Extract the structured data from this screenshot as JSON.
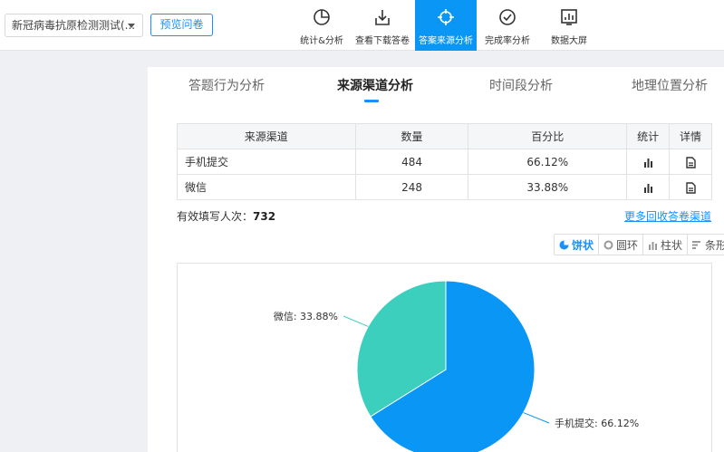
{
  "header": {
    "survey_title": "新冠病毒抗原检测测试(...",
    "preview_label": "预览问卷",
    "nav": [
      {
        "label": "统计&分析",
        "icon": "pie-chart-icon"
      },
      {
        "label": "查看下载答卷",
        "icon": "download-icon"
      },
      {
        "label": "答案来源分析",
        "icon": "crosshair-icon",
        "active": true
      },
      {
        "label": "完成率分析",
        "icon": "check-circle-icon"
      },
      {
        "label": "数据大屏",
        "icon": "dashboard-icon"
      }
    ]
  },
  "tabs": [
    {
      "label": "答题行为分析"
    },
    {
      "label": "来源渠道分析",
      "active": true
    },
    {
      "label": "时间段分析"
    },
    {
      "label": "地理位置分析"
    }
  ],
  "table": {
    "headers": [
      "来源渠道",
      "数量",
      "百分比",
      "统计",
      "详情"
    ],
    "rows": [
      {
        "channel": "手机提交",
        "count": "484",
        "percent": "66.12%"
      },
      {
        "channel": "微信",
        "count": "248",
        "percent": "33.88%"
      }
    ]
  },
  "summary": {
    "label": "有效填写人次：",
    "value": "732",
    "more_link": "更多回收答卷渠道"
  },
  "chart_switch": [
    {
      "label": "饼状",
      "active": true
    },
    {
      "label": "圆环"
    },
    {
      "label": "柱状"
    },
    {
      "label": "条形"
    }
  ],
  "colors": {
    "accent": "#1890ff",
    "slice_1": "#0a96f4",
    "slice_2": "#3ccfbe"
  },
  "chart_data": {
    "type": "pie",
    "categories": [
      "手机提交",
      "微信"
    ],
    "values": [
      66.12,
      33.88
    ],
    "labels": [
      "手机提交: 66.12%",
      "微信: 33.88%"
    ]
  }
}
